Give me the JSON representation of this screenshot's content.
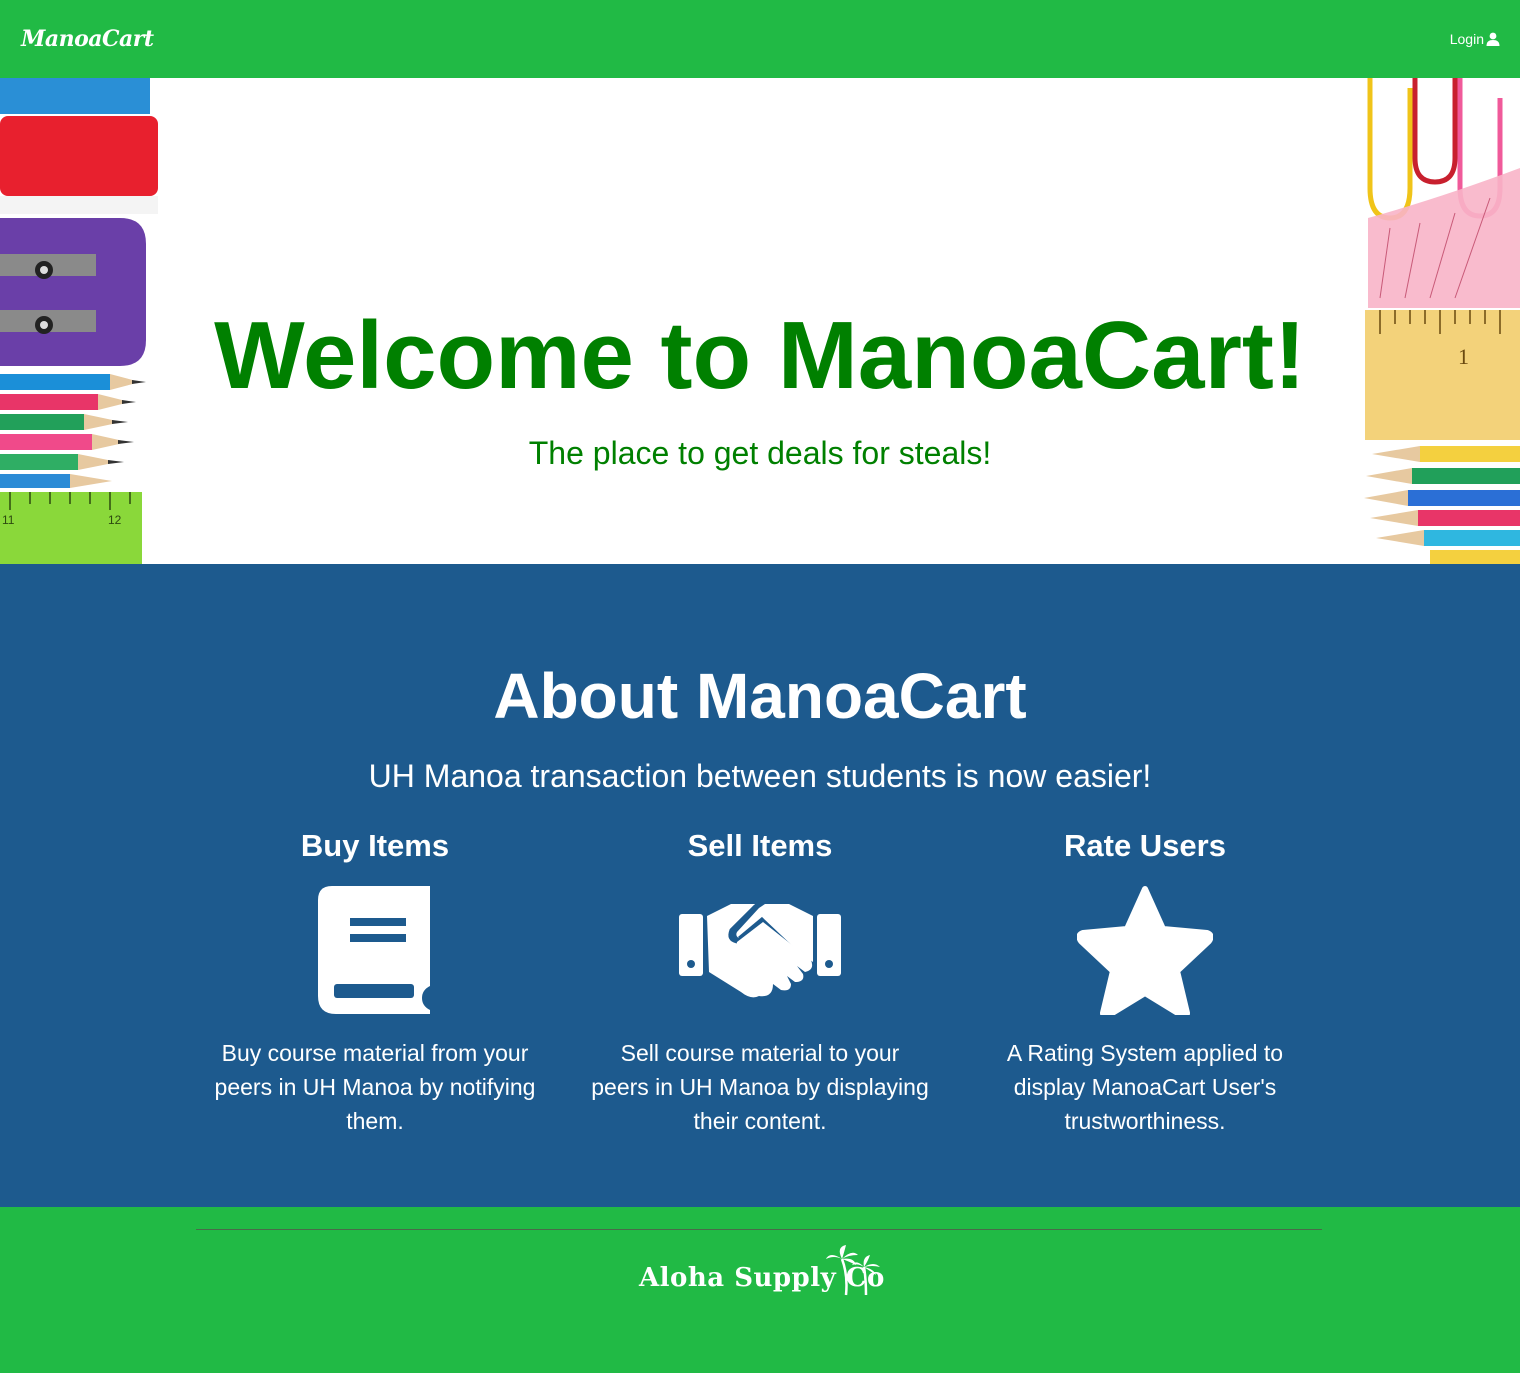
{
  "navbar": {
    "brand": "ManoaCart",
    "login_label": "Login",
    "login_icon": "user-icon",
    "background": "#21ba45"
  },
  "hero": {
    "title": "Welcome to ManoaCart!",
    "subtitle": "The place to get deals for steals!",
    "title_color": "#008000"
  },
  "about": {
    "title": "About ManoaCart",
    "subtitle": "UH Manoa transaction between students is now easier!",
    "background": "#1d5a8e",
    "features": [
      {
        "title": "Buy Items",
        "icon": "book-icon",
        "description": "Buy course material from your peers in UH Manoa by notifying them."
      },
      {
        "title": "Sell Items",
        "icon": "handshake-icon",
        "description": "Sell course material to your peers in UH Manoa by displaying their content."
      },
      {
        "title": "Rate Users",
        "icon": "star-icon",
        "description": "A Rating System applied to display ManoaCart User's trustworthiness."
      }
    ]
  },
  "footer": {
    "logo_text": "Aloha Supply Co",
    "logo_icon": "palm-tree-icon"
  }
}
